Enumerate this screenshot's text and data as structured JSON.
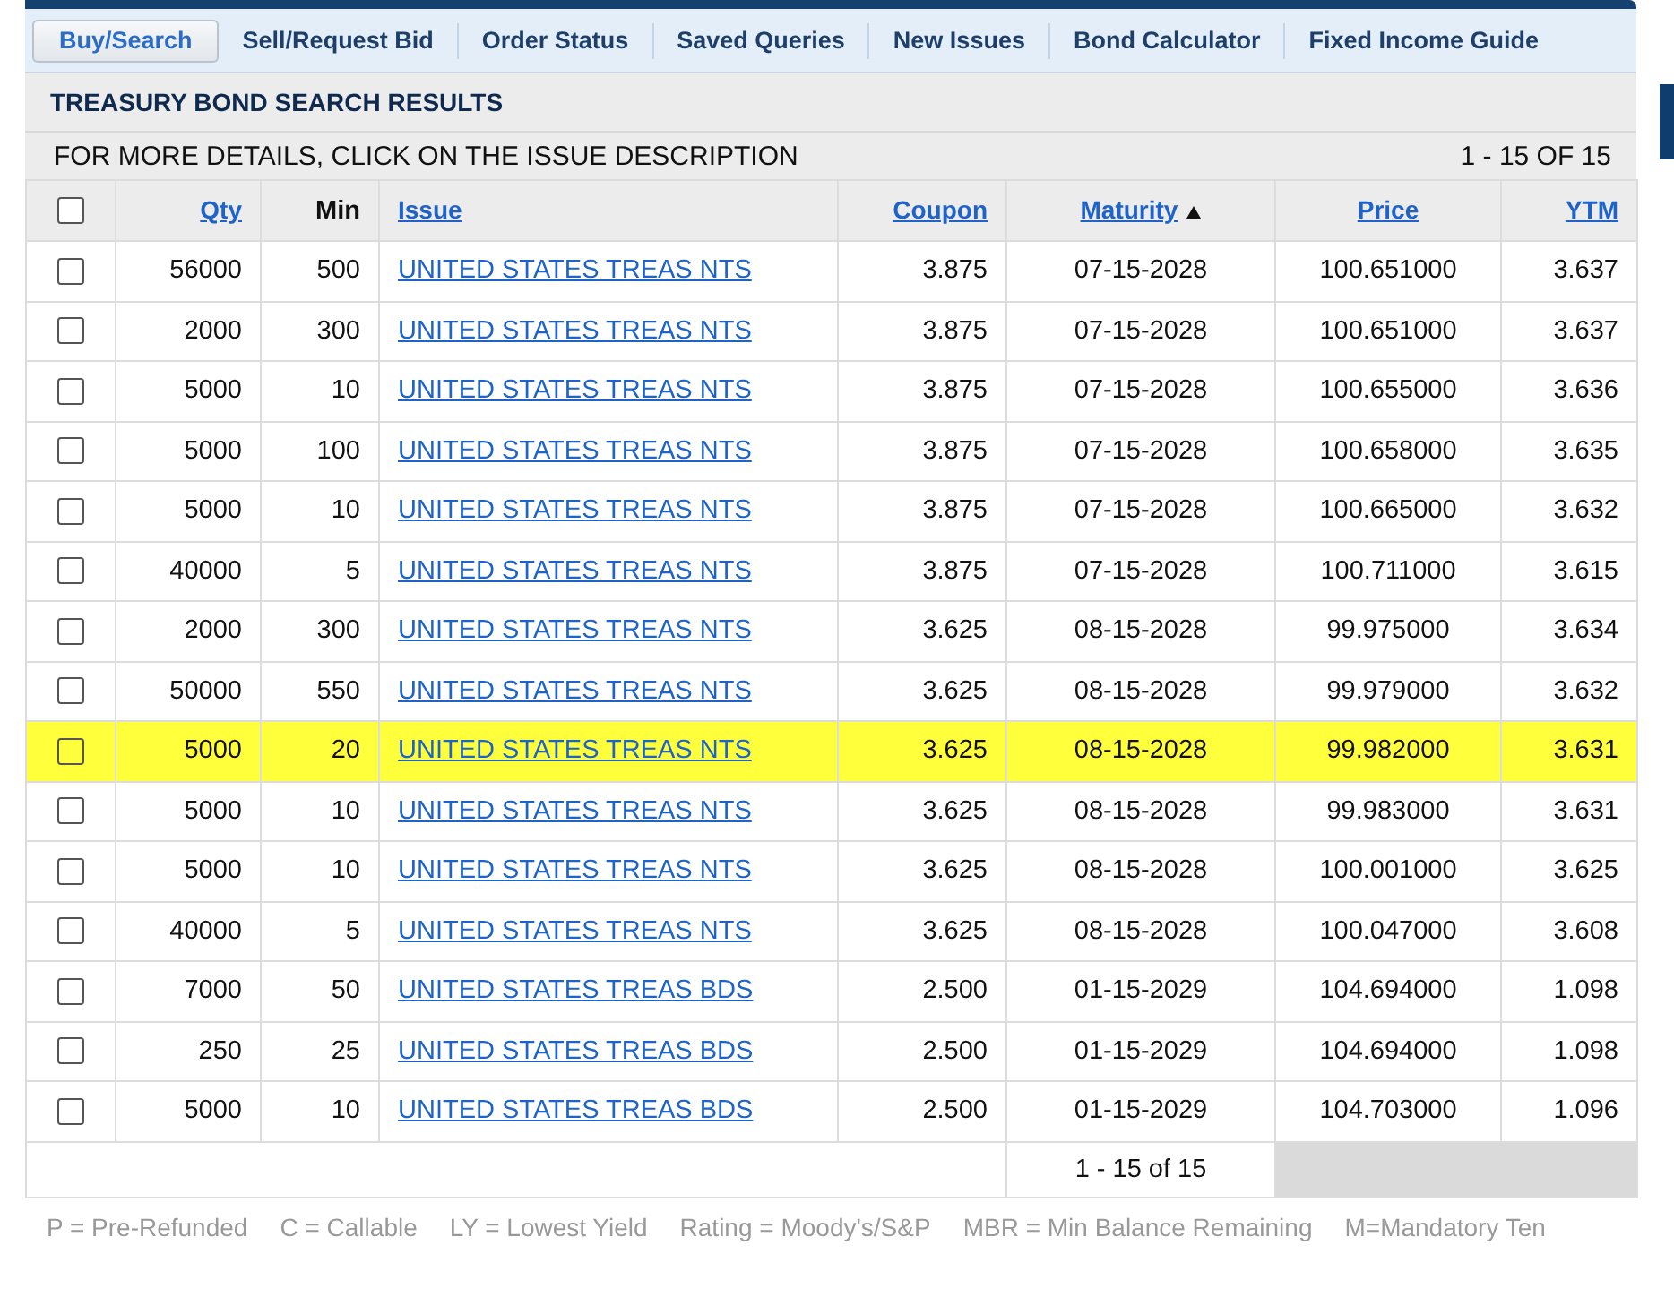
{
  "tabs": [
    {
      "label": "Buy/Search",
      "selected": true
    },
    {
      "label": "Sell/Request Bid",
      "selected": false
    },
    {
      "label": "Order Status",
      "selected": false
    },
    {
      "label": "Saved Queries",
      "selected": false
    },
    {
      "label": "New Issues",
      "selected": false
    },
    {
      "label": "Bond Calculator",
      "selected": false
    },
    {
      "label": "Fixed Income Guide",
      "selected": false
    }
  ],
  "title": "TREASURY BOND SEARCH RESULTS",
  "instruction": "FOR MORE DETAILS, CLICK ON THE ISSUE DESCRIPTION",
  "range": "1 - 15 OF 15",
  "select_all": {
    "checked": false
  },
  "columns": [
    {
      "label": "Qty",
      "kind": "link",
      "sorted": false
    },
    {
      "label": "Min",
      "kind": "plain",
      "sorted": false
    },
    {
      "label": "Issue",
      "kind": "link",
      "sorted": false
    },
    {
      "label": "Coupon",
      "kind": "link",
      "sorted": false
    },
    {
      "label": "Maturity",
      "kind": "link",
      "sorted": true
    },
    {
      "label": "Price",
      "kind": "link",
      "sorted": false
    },
    {
      "label": "YTM",
      "kind": "link",
      "sorted": false
    }
  ],
  "rows": [
    {
      "checked": false,
      "highlighted": false,
      "cells": [
        "56000",
        "500",
        "UNITED STATES TREAS NTS",
        "3.875",
        "07-15-2028",
        "100.651000",
        "3.637"
      ]
    },
    {
      "checked": false,
      "highlighted": false,
      "cells": [
        "2000",
        "300",
        "UNITED STATES TREAS NTS",
        "3.875",
        "07-15-2028",
        "100.651000",
        "3.637"
      ]
    },
    {
      "checked": false,
      "highlighted": false,
      "cells": [
        "5000",
        "10",
        "UNITED STATES TREAS NTS",
        "3.875",
        "07-15-2028",
        "100.655000",
        "3.636"
      ]
    },
    {
      "checked": false,
      "highlighted": false,
      "cells": [
        "5000",
        "100",
        "UNITED STATES TREAS NTS",
        "3.875",
        "07-15-2028",
        "100.658000",
        "3.635"
      ]
    },
    {
      "checked": false,
      "highlighted": false,
      "cells": [
        "5000",
        "10",
        "UNITED STATES TREAS NTS",
        "3.875",
        "07-15-2028",
        "100.665000",
        "3.632"
      ]
    },
    {
      "checked": false,
      "highlighted": false,
      "cells": [
        "40000",
        "5",
        "UNITED STATES TREAS NTS",
        "3.875",
        "07-15-2028",
        "100.711000",
        "3.615"
      ]
    },
    {
      "checked": false,
      "highlighted": false,
      "cells": [
        "2000",
        "300",
        "UNITED STATES TREAS NTS",
        "3.625",
        "08-15-2028",
        "99.975000",
        "3.634"
      ]
    },
    {
      "checked": false,
      "highlighted": false,
      "cells": [
        "50000",
        "550",
        "UNITED STATES TREAS NTS",
        "3.625",
        "08-15-2028",
        "99.979000",
        "3.632"
      ]
    },
    {
      "checked": false,
      "highlighted": true,
      "cells": [
        "5000",
        "20",
        "UNITED STATES TREAS NTS",
        "3.625",
        "08-15-2028",
        "99.982000",
        "3.631"
      ]
    },
    {
      "checked": false,
      "highlighted": false,
      "cells": [
        "5000",
        "10",
        "UNITED STATES TREAS NTS",
        "3.625",
        "08-15-2028",
        "99.983000",
        "3.631"
      ]
    },
    {
      "checked": false,
      "highlighted": false,
      "cells": [
        "5000",
        "10",
        "UNITED STATES TREAS NTS",
        "3.625",
        "08-15-2028",
        "100.001000",
        "3.625"
      ]
    },
    {
      "checked": false,
      "highlighted": false,
      "cells": [
        "40000",
        "5",
        "UNITED STATES TREAS NTS",
        "3.625",
        "08-15-2028",
        "100.047000",
        "3.608"
      ]
    },
    {
      "checked": false,
      "highlighted": false,
      "cells": [
        "7000",
        "50",
        "UNITED STATES TREAS BDS",
        "2.500",
        "01-15-2029",
        "104.694000",
        "1.098"
      ]
    },
    {
      "checked": false,
      "highlighted": false,
      "cells": [
        "250",
        "25",
        "UNITED STATES TREAS BDS",
        "2.500",
        "01-15-2029",
        "104.694000",
        "1.098"
      ]
    },
    {
      "checked": false,
      "highlighted": false,
      "cells": [
        "5000",
        "10",
        "UNITED STATES TREAS BDS",
        "2.500",
        "01-15-2029",
        "104.703000",
        "1.096"
      ]
    }
  ],
  "footer_range": "1 - 15 of 15",
  "legend": [
    "P = Pre-Refunded",
    "C = Callable",
    "LY = Lowest Yield",
    "Rating = Moody's/S&P",
    "MBR = Min Balance Remaining",
    "M=Mandatory Ten"
  ]
}
